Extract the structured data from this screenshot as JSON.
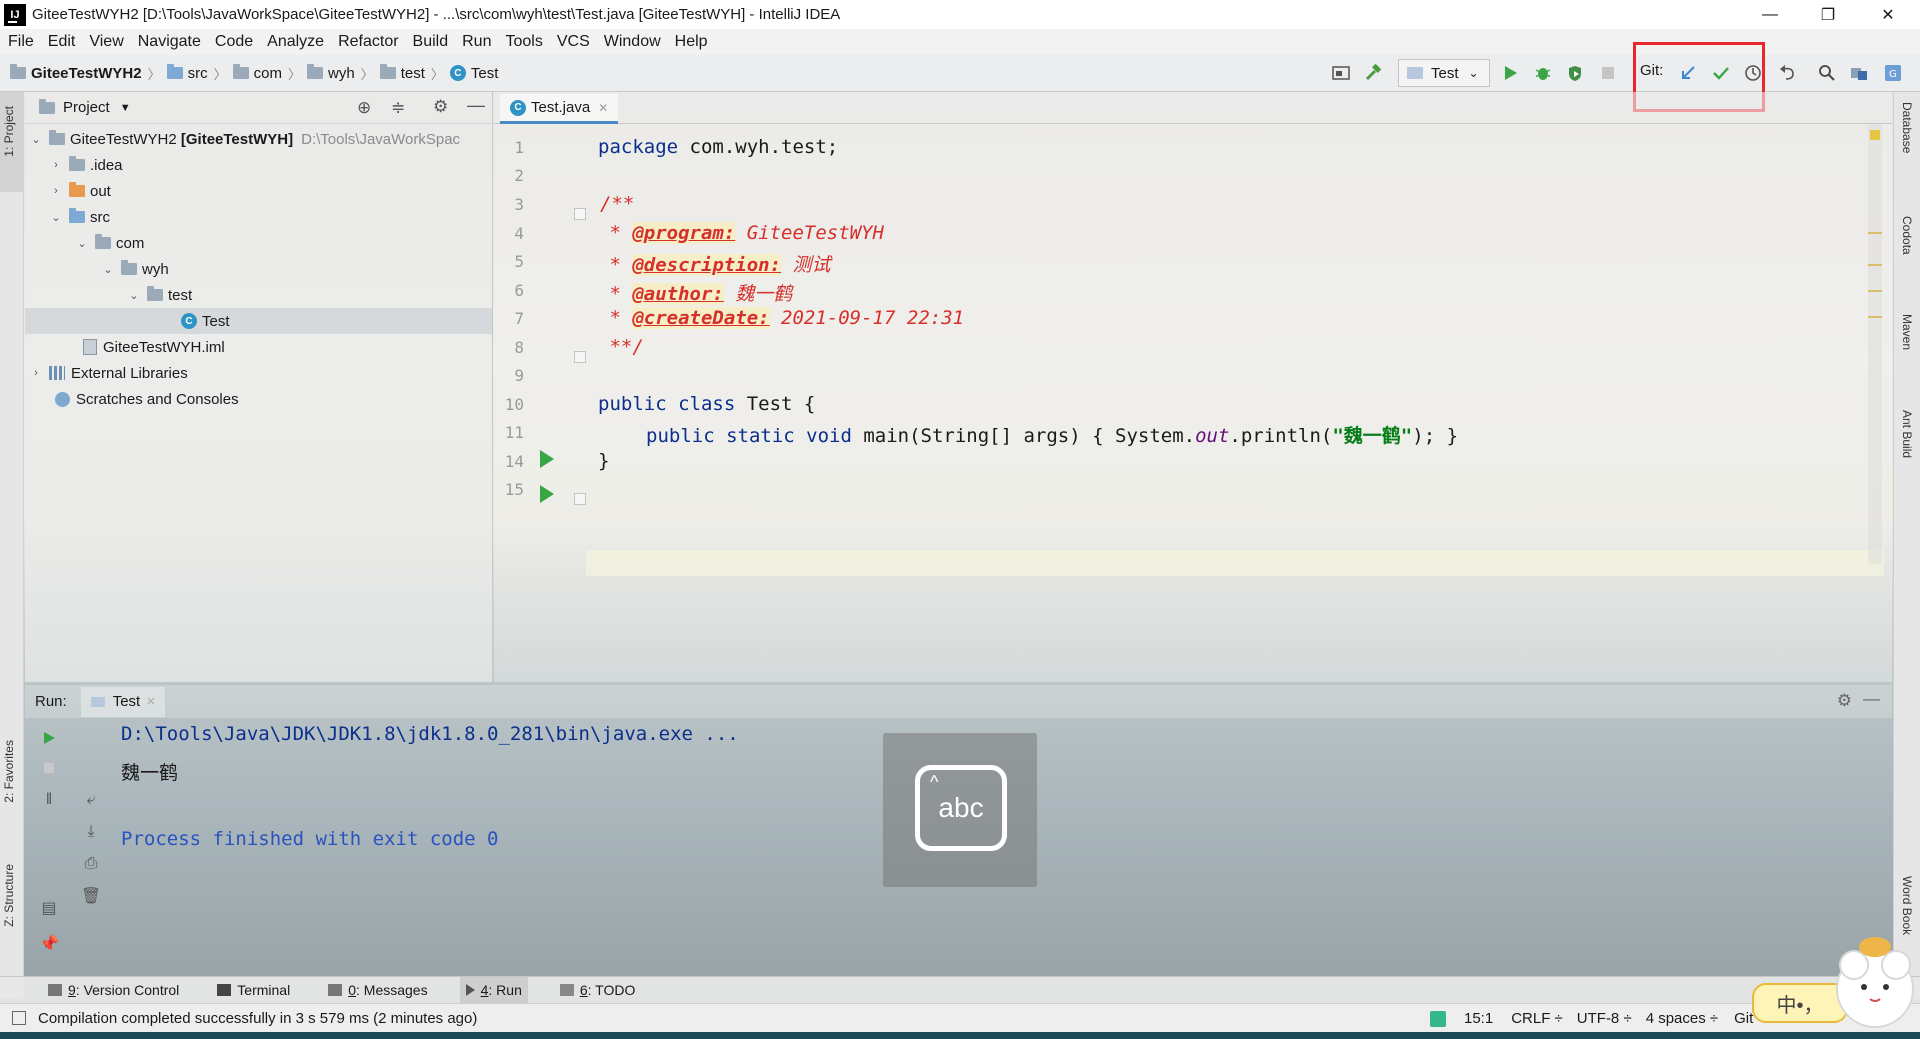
{
  "window": {
    "title": "GiteeTestWYH2 [D:\\Tools\\JavaWorkSpace\\GiteeTestWYH2] - ...\\src\\com\\wyh\\test\\Test.java [GiteeTestWYH] - IntelliJ IDEA",
    "minimize": "—",
    "restore": "❐",
    "close": "✕"
  },
  "menu": [
    "File",
    "Edit",
    "View",
    "Navigate",
    "Code",
    "Analyze",
    "Refactor",
    "Build",
    "Run",
    "Tools",
    "VCS",
    "Window",
    "Help"
  ],
  "breadcrumbs": [
    "GiteeTestWYH2",
    "src",
    "com",
    "wyh",
    "test",
    "Test"
  ],
  "toolbar": {
    "run_config": "Test",
    "git_label": "Git:"
  },
  "left_stripe": {
    "project_tab": "1: Project",
    "favorites_tab": "2: Favorites",
    "structure_tab": "Z: Structure"
  },
  "right_stripe": [
    "Database",
    "Codota",
    "Maven",
    "Ant Build",
    "Word Book"
  ],
  "project_panel": {
    "header": "Project",
    "tree": [
      {
        "label": "GiteeTestWYH2",
        "bold_suffix": "[GiteeTestWYH]",
        "path": "D:\\Tools\\JavaWorkSpac",
        "arrow": "expanded",
        "icon": "module"
      },
      {
        "label": ".idea",
        "arrow": "collapsed",
        "icon": "folder"
      },
      {
        "label": "out",
        "arrow": "collapsed",
        "icon": "folder-orange"
      },
      {
        "label": "src",
        "arrow": "expanded",
        "icon": "folder-blue"
      },
      {
        "label": "com",
        "arrow": "expanded",
        "icon": "package"
      },
      {
        "label": "wyh",
        "arrow": "expanded",
        "icon": "package"
      },
      {
        "label": "test",
        "arrow": "expanded",
        "icon": "package"
      },
      {
        "label": "Test",
        "arrow": "none",
        "icon": "class",
        "selected": true
      },
      {
        "label": "GiteeTestWYH.iml",
        "arrow": "none",
        "icon": "iml"
      },
      {
        "label": "External Libraries",
        "arrow": "collapsed",
        "icon": "libraries"
      },
      {
        "label": "Scratches and Consoles",
        "arrow": "none",
        "icon": "scratches"
      }
    ]
  },
  "editor": {
    "tab": "Test.java",
    "line_numbers": [
      "1",
      "2",
      "3",
      "4",
      "5",
      "6",
      "7",
      "8",
      "9",
      "10",
      "11",
      "14",
      "15"
    ],
    "lines": {
      "l1_kw": "package",
      "l1_rest": " com.wyh.test;",
      "l3": "/**",
      "l4_pre": " * ",
      "l4_tag": "@program:",
      "l4_val": " GiteeTestWYH",
      "l5_tag": "@description:",
      "l5_val": " 测试",
      "l6_tag": "@author:",
      "l6_val": " 魏一鹤",
      "l7_tag": "@createDate:",
      "l7_val": " 2021-09-17 22:31",
      "l8": " **/",
      "l10_kw": "public class",
      "l10_rest": " Test {",
      "l11_kw": "public static void",
      "l11_a": " main(String[] args) { System.",
      "l11_field": "out",
      "l11_b": ".println(",
      "l11_str": "\"魏一鹤\"",
      "l11_c": "); }",
      "l14": "}"
    }
  },
  "run_panel": {
    "label": "Run:",
    "tab": "Test",
    "output": [
      "D:\\Tools\\Java\\JDK\\JDK1.8\\jdk1.8.0_281\\bin\\java.exe ...",
      "魏一鹤",
      "Process finished with exit code 0"
    ]
  },
  "ime_overlay": {
    "text": "abc"
  },
  "bottom_tabs": [
    {
      "key": "9",
      "label": ": Version Control"
    },
    {
      "key": "",
      "label": "Terminal"
    },
    {
      "key": "0",
      "label": ": Messages"
    },
    {
      "key": "4",
      "label": ": Run"
    },
    {
      "key": "6",
      "label": ": TODO"
    }
  ],
  "status": {
    "message": "Compilation completed successfully in 3 s 579 ms (2 minutes ago)",
    "position": "15:1",
    "line_sep": "CRLF ÷",
    "encoding": "UTF-8 ÷",
    "indent": "4 spaces ÷",
    "vcs": "Git",
    "ime_badge": "中•，"
  },
  "colors": {
    "accent_red_box": "#e8262c",
    "run_green": "#3aa545",
    "keyword": "#0b2f8c",
    "comment_red": "#d5302b",
    "string_green": "#067d17"
  }
}
